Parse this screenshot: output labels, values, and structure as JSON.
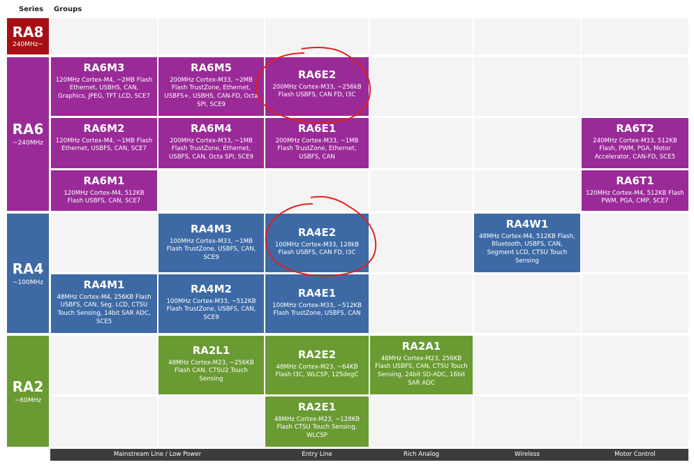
{
  "headers": {
    "series": "Series",
    "groups": "Groups"
  },
  "series": {
    "ra8": {
      "name": "RA8",
      "freq": "240MHz~"
    },
    "ra6": {
      "name": "RA6",
      "freq": "~240MHz"
    },
    "ra4": {
      "name": "RA4",
      "freq": "~100MHz"
    },
    "ra2": {
      "name": "RA2",
      "freq": "~60MHz"
    }
  },
  "groups": {
    "mainstream": "Mainstream Line / Low Power",
    "entry": "Entry Line",
    "rich_analog": "Rich Analog",
    "wireless": "Wireless",
    "motor_control": "Motor Control"
  },
  "cells": {
    "ra6m3": {
      "title": "RA6M3",
      "desc": "120MHz Cortex-M4, ~2MB Flash Ethernet, USBHS, CAN, Graphics, JPEG, TFT LCD, SCE7"
    },
    "ra6m5": {
      "title": "RA6M5",
      "desc": "200MHz Cortex-M33, ~2MB Flash TrustZone, Ethernet, USBFS+, USBHS, CAN-FD, Octa SPI, SCE9"
    },
    "ra6e2": {
      "title": "RA6E2",
      "desc": "200MHz Cortex-M33, ~256kB Flash USBFS, CAN FD, I3C"
    },
    "ra6m2": {
      "title": "RA6M2",
      "desc": "120MHz Cortex-M4, ~1MB Flash Ethernet, USBFS, CAN, SCE7"
    },
    "ra6m4": {
      "title": "RA6M4",
      "desc": "200MHz Cortex-M33, ~1MB Flash TrustZone, Ethernet, USBFS, CAN, Octa SPI, SCE9"
    },
    "ra6e1": {
      "title": "RA6E1",
      "desc": "200MHz Cortex-M33, ~1MB Flash TrustZone, Ethernet, USBFS, CAN"
    },
    "ra6t2": {
      "title": "RA6T2",
      "desc": "240MHz Cortex-M33, 512KB Flash, PWM, PGA, Motor Accelerator, CAN-FD, SCE5"
    },
    "ra6m1": {
      "title": "RA6M1",
      "desc": "120MHz Cortex-M4, 512KB Flash USBFS, CAN, SCE7"
    },
    "ra6t1": {
      "title": "RA6T1",
      "desc": "120MHz Cortex-M4, 512KB Flash PWM, PGA, CMP, SCE7"
    },
    "ra4m3": {
      "title": "RA4M3",
      "desc": "100MHz Cortex-M33, ~1MB Flash TrustZone, USBFS, CAN, SCE9"
    },
    "ra4e2": {
      "title": "RA4E2",
      "desc": "100MHz Cortex-M33, 128kB Flash USBFS, CAN FD, I3C"
    },
    "ra4w1": {
      "title": "RA4W1",
      "desc": "48MHz Cortex-M4, 512KB Flash, Bluetooth, USBFS, CAN, Segment LCD, CTSU Touch Sensing"
    },
    "ra4m1": {
      "title": "RA4M1",
      "desc": "48MHz Cortex-M4, 256KB Flash USBFS, CAN, Seg. LCD, CTSU Touch Sensing, 14bit SAR ADC, SCE5"
    },
    "ra4m2": {
      "title": "RA4M2",
      "desc": "100MHz Cortex-M33, ~512KB Flash TrustZone, USBFS, CAN, SCE9"
    },
    "ra4e1": {
      "title": "RA4E1",
      "desc": "100MHz Cortex-M33, ~512KB Flash TrustZone, USBFS, CAN"
    },
    "ra2l1": {
      "title": "RA2L1",
      "desc": "48MHz Cortex-M23, ~256KB Flash CAN, CTSU2 Touch Sensing"
    },
    "ra2e2": {
      "title": "RA2E2",
      "desc": "48MHz Cortex-M23, ~64KB Flash I3C, WLCSP, 125degC"
    },
    "ra2a1": {
      "title": "RA2A1",
      "desc": "48MHz Cortex-M23, 256KB Flash USBFS, CAN, CTSU Touch Sensing, 24bit SD-ADC, 16bit SAR ADC"
    },
    "ra2e1": {
      "title": "RA2E1",
      "desc": "48MHz Cortex-M23, ~128KB Flash CTSU Touch Sensing, WLCSP"
    }
  },
  "colors": {
    "ra8": "#a60f14",
    "ra6": "#9a2a98",
    "ra4": "#3d6aa5",
    "ra2": "#6a9b33",
    "annotation": "#e0201b"
  }
}
